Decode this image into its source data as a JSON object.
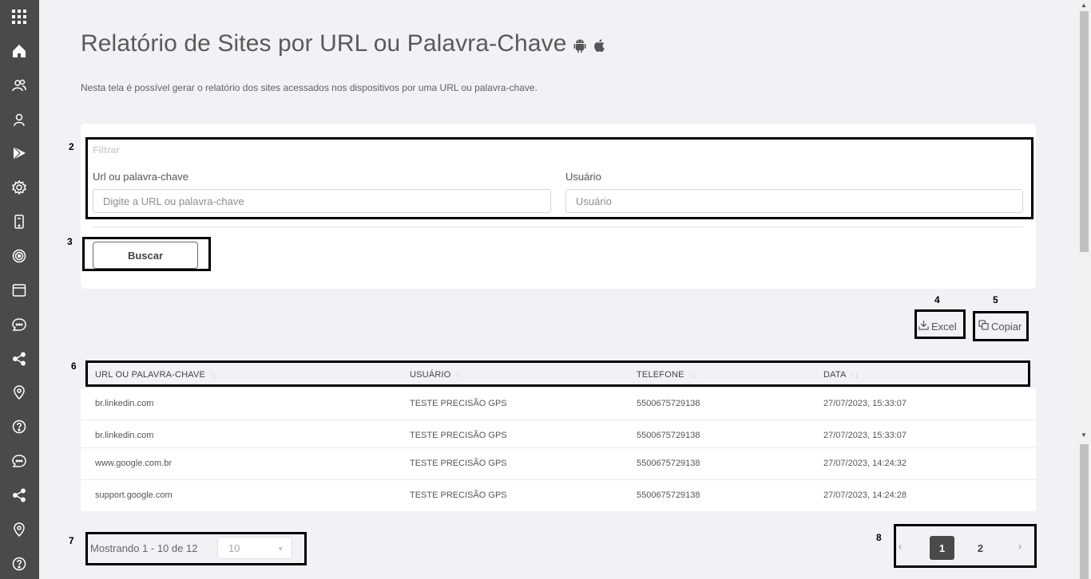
{
  "sidebar": {
    "icons": [
      "apps-grid-icon",
      "home-icon",
      "users-icon",
      "user-icon",
      "play-store-icon",
      "settings-icon",
      "device-icon",
      "target-icon",
      "browser-icon",
      "chat-icon",
      "share-icon",
      "location-icon",
      "help-icon",
      "chat-icon-2",
      "share-icon-2",
      "location-icon-2",
      "help-icon-2"
    ]
  },
  "header": {
    "title": "Relatório de Sites por URL ou Palavra-Chave",
    "platform_icons": [
      "android-icon",
      "apple-icon"
    ],
    "subtitle": "Nesta tela é possível gerar o relatório dos sites acessados nos dispositivos por uma URL ou palavra-chave."
  },
  "filter": {
    "title": "Filtrar",
    "url_label": "Url ou palavra-chave",
    "url_placeholder": "Digite a URL ou palavra-chave",
    "user_label": "Usuário",
    "user_placeholder": "Usuário",
    "search_button": "Buscar"
  },
  "annotations": {
    "n2": "2",
    "n3": "3",
    "n4": "4",
    "n5": "5",
    "n6": "6",
    "n7": "7",
    "n8": "8"
  },
  "export": {
    "excel": "Excel",
    "copy": "Copiar"
  },
  "table": {
    "columns": [
      "URL OU PALAVRA-CHAVE",
      "USUÁRIO",
      "TELEFONE",
      "DATA"
    ],
    "sort_glyph": "↑↓",
    "rows": [
      [
        "br.linkedin.com",
        "TESTE PRECISÃO GPS",
        "5500675729138",
        "27/07/2023, 15:33:07"
      ],
      [
        "br.linkedin.com",
        "TESTE PRECISÃO GPS",
        "5500675729138",
        "27/07/2023, 15:33:07"
      ],
      [
        "www.google.com.br",
        "TESTE PRECISÃO GPS",
        "5500675729138",
        "27/07/2023, 14:24:32"
      ],
      [
        "support.google.com",
        "TESTE PRECISÃO GPS",
        "5500675729138",
        "27/07/2023, 14:24:28"
      ]
    ]
  },
  "pagination": {
    "showing": "Mostrando 1 - 10 de 12",
    "page_size": "10",
    "prev": "‹",
    "next": "›",
    "pages": [
      "1",
      "2"
    ],
    "current_page": "1"
  },
  "colors": {
    "sidebar_bg": "#4a4a4a",
    "page_bg": "#f1f2f5",
    "active_page": "#4a4a4a"
  }
}
